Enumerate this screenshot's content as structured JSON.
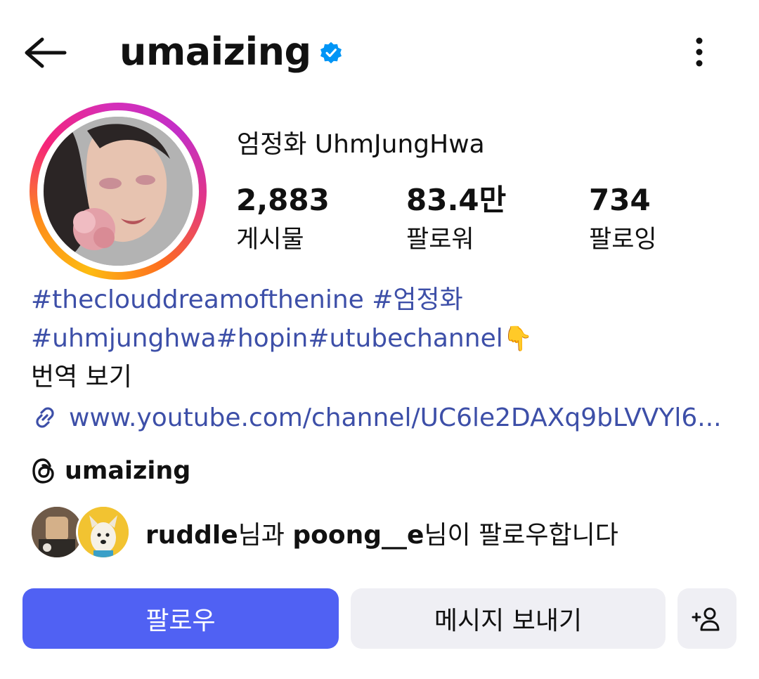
{
  "header": {
    "username": "umaizing",
    "back_icon": "arrow-left-icon",
    "verified_icon": "verified-badge-icon",
    "menu_icon": "more-vertical-icon"
  },
  "profile": {
    "full_name": "엄정화 UhmJungHwa",
    "stats": {
      "posts": {
        "value": "2,883",
        "label": "게시물"
      },
      "followers": {
        "value": "83.4만",
        "label": "팔로워"
      },
      "following": {
        "value": "734",
        "label": "팔로잉"
      }
    }
  },
  "bio": {
    "line1": "#theclouddreamofthenine #엄정화",
    "line2": "#uhmjunghwa#hopin#utubechannel",
    "emoji": "👇",
    "translate_label": "번역 보기",
    "link": "www.youtube.com/channel/UC6le2DAXq9bLVVYl6...",
    "link_icon": "link-icon",
    "threads_handle": "umaizing",
    "threads_icon": "threads-icon"
  },
  "followed_by": {
    "user1": "ruddle",
    "mid": "님과 ",
    "user2": "poong__e",
    "suffix": "님이 팔로우합니다"
  },
  "actions": {
    "follow_label": "팔로우",
    "message_label": "메시지 보내기",
    "add_user_icon": "add-user-icon"
  },
  "colors": {
    "follow_button": "#5061f3",
    "secondary_button": "#efeff4",
    "link_text": "#3d4fa8",
    "verified_badge": "#0095f6"
  }
}
